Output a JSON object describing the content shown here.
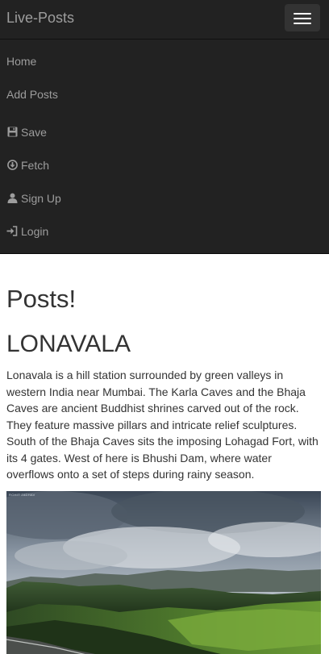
{
  "navbar": {
    "brand": "Live-Posts",
    "menu": [
      {
        "label": "Home",
        "icon": ""
      },
      {
        "label": "Add Posts",
        "icon": ""
      },
      {
        "label": "Save",
        "icon": "floppy-disk-icon"
      },
      {
        "label": "Fetch",
        "icon": "download-circle-icon"
      },
      {
        "label": "Sign Up",
        "icon": "user-icon"
      },
      {
        "label": "Login",
        "icon": "log-in-icon"
      }
    ]
  },
  "main": {
    "heading": "Posts!",
    "posts": [
      {
        "title": "LONAVALA",
        "body": "Lonavala is a hill station surrounded by green valleys in western India near Mumbai. The Karla Caves and the Bhaja Caves are ancient Buddhist shrines carved out of the rock. They feature massive pillars and intricate relief sculptures. South of the Bhaja Caves sits the imposing Lohagad Fort, with its 4 gates. West of here is Bhushi Dam, where water overflows onto a set of steps during rainy season.",
        "image_watermark": "Rohit Jadhav"
      }
    ]
  },
  "colors": {
    "navbar_bg": "#222222",
    "nav_text": "#9d9d9d",
    "body_text": "#333333"
  }
}
